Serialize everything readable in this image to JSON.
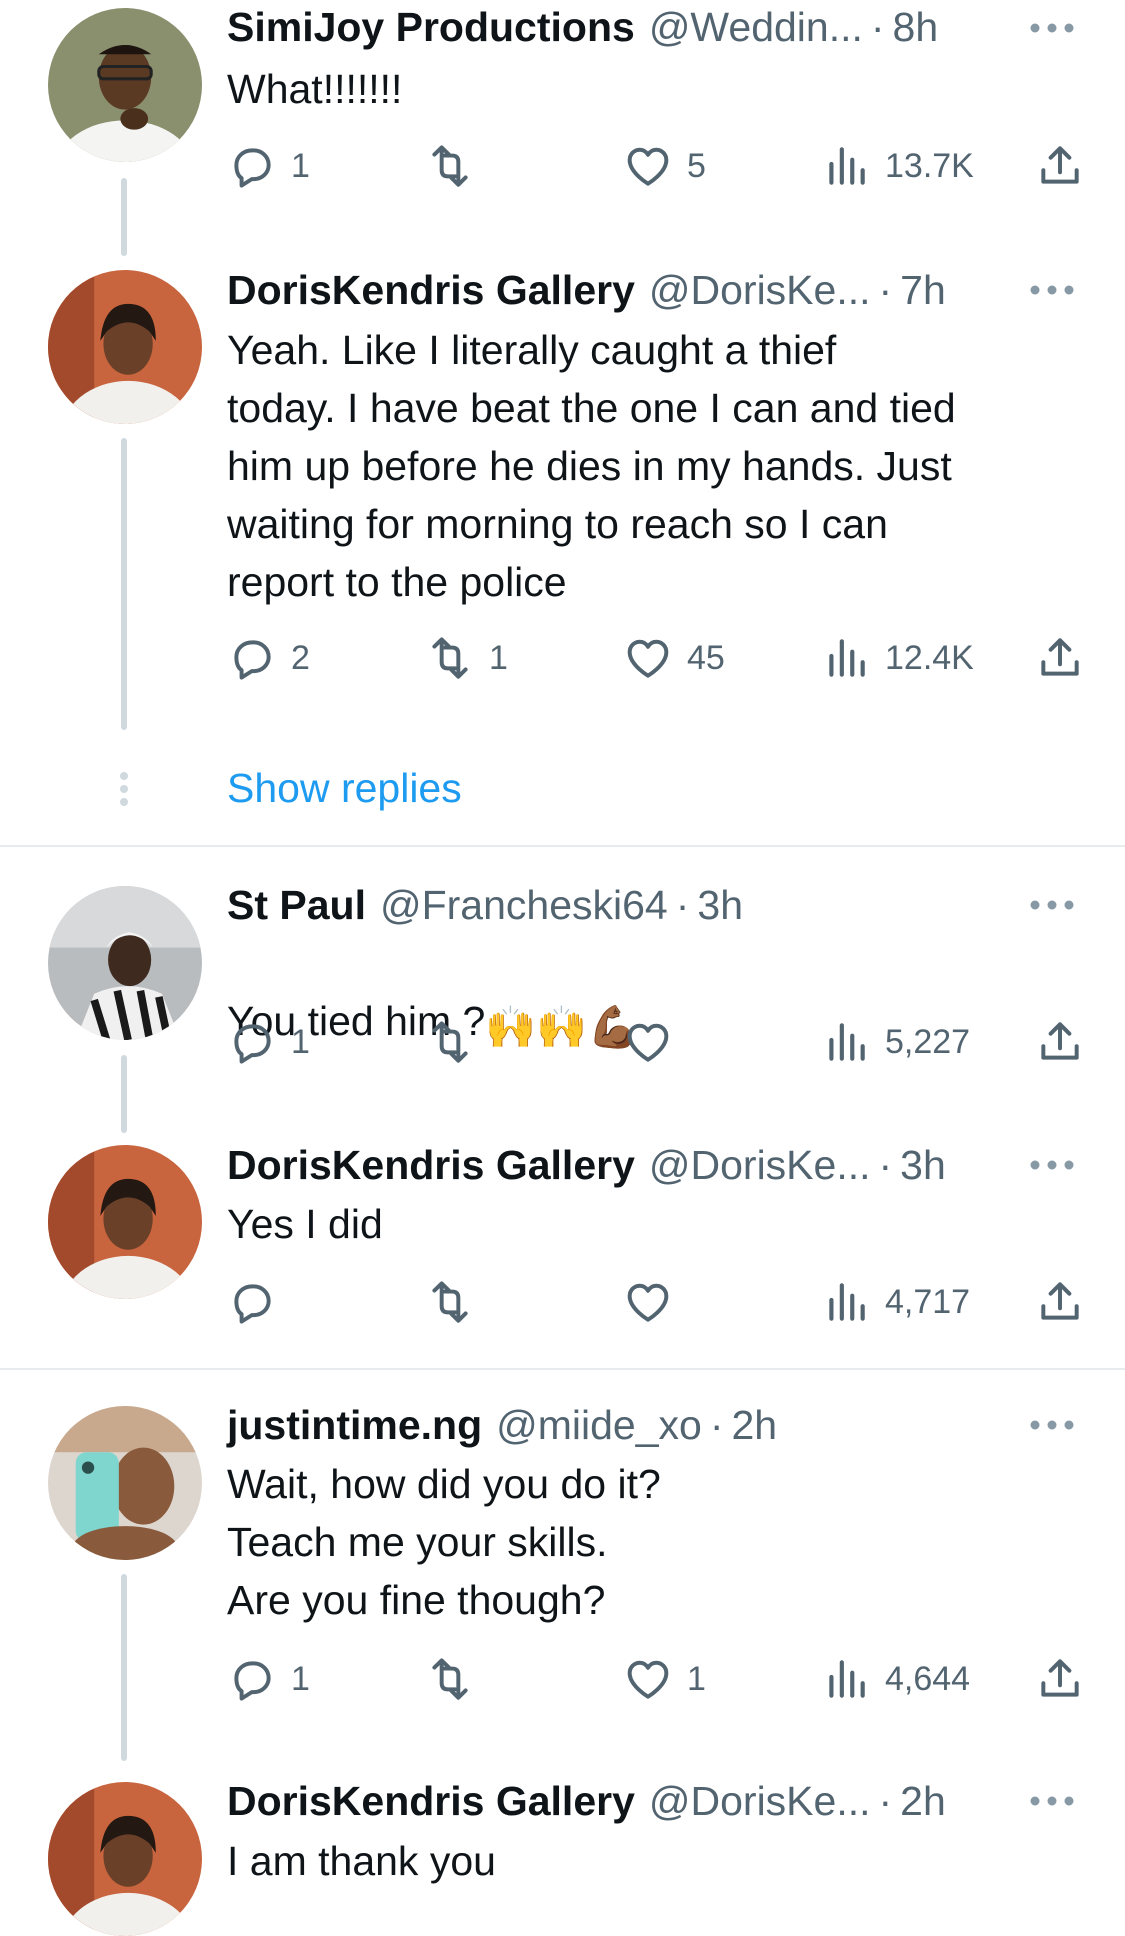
{
  "colors": {
    "accent": "#1d9bf0",
    "muted": "#536471",
    "text": "#0f1419",
    "thread_line": "#cfd9de"
  },
  "tweets": [
    {
      "name": "SimiJoy Productions",
      "handle": "@Weddin...",
      "dot": "·",
      "time": "8h",
      "text": "What!!!!!!!",
      "replies": "1",
      "retweets": "",
      "likes": "5",
      "views": "13.7K"
    },
    {
      "name": "DorisKendris Gallery",
      "handle": "@DorisKe...",
      "dot": "·",
      "time": "7h",
      "text": "Yeah. Like I literally caught a thief\ntoday. I have beat the one I can and tied\nhim up before he dies in my hands. Just\nwaiting for morning to reach so I can\nreport to the police",
      "replies": "2",
      "retweets": "1",
      "likes": "45",
      "views": "12.4K"
    },
    {
      "name": "St Paul",
      "handle": "@Francheski64",
      "dot": "·",
      "time": "3h",
      "text": "You tied him ?",
      "emoji": "🙌🙌💪🏾",
      "replies": "1",
      "retweets": "",
      "likes": "",
      "views": "5,227"
    },
    {
      "name": "DorisKendris Gallery",
      "handle": "@DorisKe...",
      "dot": "·",
      "time": "3h",
      "text": "Yes I did",
      "replies": "",
      "retweets": "",
      "likes": "",
      "views": "4,717"
    },
    {
      "name": "justintime.ng",
      "handle": "@miide_xo",
      "dot": "·",
      "time": "2h",
      "text": "Wait, how did you do it?\nTeach me your skills.\nAre you fine though?",
      "replies": "1",
      "retweets": "",
      "likes": "1",
      "views": "4,644"
    },
    {
      "name": "DorisKendris Gallery",
      "handle": "@DorisKe...",
      "dot": "·",
      "time": "2h",
      "text": "I am thank you"
    }
  ],
  "show_replies_label": "Show replies",
  "icons": {
    "reply": "reply-icon",
    "retweet": "retweet-icon",
    "like": "heart-icon",
    "views": "views-icon",
    "share": "share-icon",
    "more": "more-icon"
  }
}
